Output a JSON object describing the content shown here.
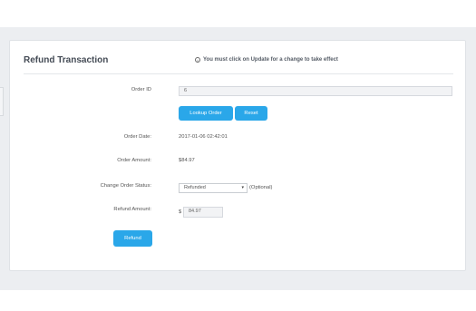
{
  "panel": {
    "title": "Refund Transaction",
    "notice": "You must click on Update for a change to take effect"
  },
  "form": {
    "order_id": {
      "label": "Order ID",
      "value": "6"
    },
    "lookup_button": "Lookup Order",
    "reset_button": "Reset",
    "order_date": {
      "label": "Order Date:",
      "value": "2017-01-06 02:42:01"
    },
    "order_amount": {
      "label": "Order Amount:",
      "value": "$84.97"
    },
    "order_status": {
      "label": "Change Order Status:",
      "selected": "Refunded",
      "note": "(Optional)"
    },
    "refund_amount": {
      "label": "Refund Amount:",
      "currency": "$",
      "value": "84.97"
    },
    "refund_button": "Refund"
  },
  "colors": {
    "accent": "#2aa7e9",
    "page_bg": "#eceef1"
  },
  "icons": {
    "notice_icon": "info-icon",
    "select_icon": "chevron-down-icon"
  }
}
